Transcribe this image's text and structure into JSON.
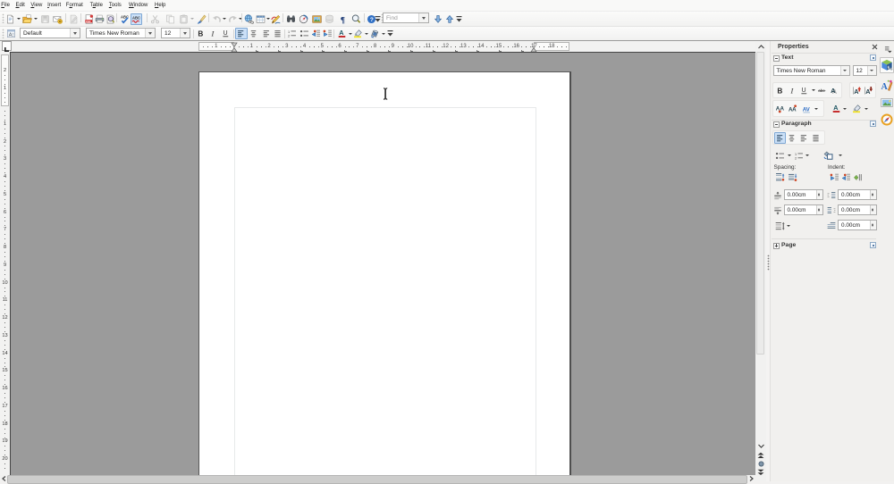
{
  "menubar": {
    "items": [
      {
        "label": "File",
        "mnemonic": 0
      },
      {
        "label": "Edit",
        "mnemonic": 0
      },
      {
        "label": "View",
        "mnemonic": 0
      },
      {
        "label": "Insert",
        "mnemonic": 0
      },
      {
        "label": "Format",
        "mnemonic": 1
      },
      {
        "label": "Table",
        "mnemonic": 1
      },
      {
        "label": "Tools",
        "mnemonic": 0
      },
      {
        "label": "Window",
        "mnemonic": 0
      },
      {
        "label": "Help",
        "mnemonic": 0
      }
    ]
  },
  "toolbar_standard": {
    "buttons": [
      {
        "id": "new-document",
        "icon": "new",
        "dropdown": true
      },
      {
        "id": "open",
        "icon": "open",
        "dropdown": true
      },
      {
        "id": "save",
        "icon": "save",
        "disabled": true
      },
      {
        "id": "email-document",
        "icon": "email"
      },
      {
        "id": "edit-file",
        "icon": "editfile",
        "disabled": true
      },
      {
        "id": "export-pdf",
        "icon": "pdf"
      },
      {
        "id": "print",
        "icon": "print"
      },
      {
        "id": "page-preview",
        "icon": "preview"
      },
      {
        "id": "spellcheck",
        "icon": "spell"
      },
      {
        "id": "auto-spellcheck",
        "icon": "autospell",
        "active": true
      },
      {
        "id": "cut",
        "icon": "cut",
        "disabled": true
      },
      {
        "id": "copy",
        "icon": "copy",
        "disabled": true
      },
      {
        "id": "paste",
        "icon": "paste",
        "disabled": true,
        "dropdown": true
      },
      {
        "id": "format-paintbrush",
        "icon": "brush"
      },
      {
        "id": "undo",
        "icon": "undo",
        "disabled": true,
        "dropdown": true
      },
      {
        "id": "redo",
        "icon": "redo",
        "disabled": true,
        "dropdown": true
      },
      {
        "id": "hyperlink",
        "icon": "hyperlink"
      },
      {
        "id": "insert-table",
        "icon": "table",
        "dropdown": true
      },
      {
        "id": "show-draw-functions",
        "icon": "draw"
      },
      {
        "id": "find-replace",
        "icon": "findreplace"
      },
      {
        "id": "navigator",
        "icon": "navigator"
      },
      {
        "id": "gallery",
        "icon": "gallery"
      },
      {
        "id": "data-sources",
        "icon": "datasources",
        "disabled": true
      },
      {
        "id": "formatting-marks",
        "icon": "marks"
      },
      {
        "id": "zoom",
        "icon": "zoomicon"
      },
      {
        "id": "help",
        "icon": "help"
      }
    ],
    "find": {
      "placeholder": "Find"
    }
  },
  "toolbar_formatting": {
    "style_combo": "Default",
    "font_combo": "Times New Roman",
    "size_combo": "12",
    "buttons": [
      {
        "id": "styles-panel",
        "icon": "stylespanel"
      },
      {
        "id": "bold",
        "icon": "boldg"
      },
      {
        "id": "italic",
        "icon": "italicg"
      },
      {
        "id": "underline",
        "icon": "underlineg"
      },
      {
        "id": "align-left",
        "icon": "alignl",
        "active": true
      },
      {
        "id": "align-center",
        "icon": "alignc"
      },
      {
        "id": "align-right",
        "icon": "alignr"
      },
      {
        "id": "justified",
        "icon": "alignj"
      },
      {
        "id": "numbering",
        "icon": "numbering"
      },
      {
        "id": "bullets",
        "icon": "bullets"
      },
      {
        "id": "decrease-indent",
        "icon": "dedent"
      },
      {
        "id": "increase-indent",
        "icon": "indent"
      },
      {
        "id": "font-color",
        "icon": "fontcolor",
        "dropdown": true
      },
      {
        "id": "highlighting",
        "icon": "highlight",
        "dropdown": true
      },
      {
        "id": "background-color",
        "icon": "bgcolor",
        "dropdown": true
      }
    ]
  },
  "ruler": {
    "unit": "cm",
    "h_numbers": [
      1,
      2,
      3,
      4,
      5,
      6,
      7,
      8,
      9,
      10,
      11,
      12,
      13,
      14,
      15,
      16,
      17,
      18
    ],
    "h_margin_numbers": [
      1
    ],
    "v_numbers": [
      1,
      2,
      3,
      4,
      5,
      6,
      7,
      8,
      9,
      10,
      11,
      12,
      13,
      14,
      15,
      16,
      17,
      18,
      19,
      20
    ],
    "v_margin_numbers": [
      2,
      1
    ]
  },
  "sidebar": {
    "title": "Properties",
    "sections": {
      "text": {
        "label": "Text",
        "font_name": "Times New Roman",
        "font_size": "12",
        "row1": [
          {
            "id": "bold",
            "icon": "boldg"
          },
          {
            "id": "italic",
            "icon": "italicg"
          },
          {
            "id": "underline",
            "icon": "underlineg",
            "dropdown": true
          },
          {
            "id": "strikethrough",
            "icon": "strike"
          },
          {
            "id": "shadow",
            "icon": "shadowa"
          }
        ],
        "row1b": [
          {
            "id": "increase-font",
            "icon": "incfont"
          },
          {
            "id": "decrease-font",
            "icon": "decfont"
          }
        ],
        "row2": [
          {
            "id": "increase-spacing",
            "icon": "spacinc"
          },
          {
            "id": "decrease-spacing",
            "icon": "spacdec"
          },
          {
            "id": "character-spacing",
            "icon": "charspace",
            "dropdown": true
          },
          {
            "id": "font-color",
            "icon": "fontcolor",
            "dropdown": true
          },
          {
            "id": "highlighting",
            "icon": "highlight",
            "dropdown": true
          }
        ]
      },
      "paragraph": {
        "label": "Paragraph",
        "align": [
          {
            "id": "align-left",
            "icon": "alignl",
            "active": true
          },
          {
            "id": "align-center",
            "icon": "alignc"
          },
          {
            "id": "align-right",
            "icon": "alignr"
          },
          {
            "id": "justified",
            "icon": "alignj"
          }
        ],
        "lists": [
          {
            "id": "bullets",
            "icon": "bullets",
            "dropdown": true
          },
          {
            "id": "numbering",
            "icon": "numbering",
            "dropdown": true
          }
        ],
        "background": {
          "id": "paragraph-background",
          "icon": "parabg",
          "dropdown": true
        },
        "spacing_label": "Spacing:",
        "indent_label": "Indent:",
        "spacing_btns": [
          {
            "id": "increase-paragraph-spacing",
            "icon": "parspinc"
          },
          {
            "id": "decrease-paragraph-spacing",
            "icon": "parspdec"
          }
        ],
        "indent_btns": [
          {
            "id": "increase-indent",
            "icon": "indent"
          },
          {
            "id": "decrease-indent",
            "icon": "dedent"
          },
          {
            "id": "switch-indent",
            "icon": "hangindent"
          }
        ],
        "above_spacing": "0.00cm",
        "below_spacing": "0.00cm",
        "before_indent": "0.00cm",
        "after_indent": "0.00cm",
        "firstline_indent": "0.00cm"
      },
      "page": {
        "label": "Page"
      }
    },
    "tabs": [
      {
        "id": "properties-deck",
        "icon": "deckprops",
        "selected": true
      },
      {
        "id": "styles-deck",
        "icon": "deckstyles"
      },
      {
        "id": "gallery-deck",
        "icon": "deckgallery"
      },
      {
        "id": "navigator-deck",
        "icon": "decknav"
      }
    ]
  }
}
